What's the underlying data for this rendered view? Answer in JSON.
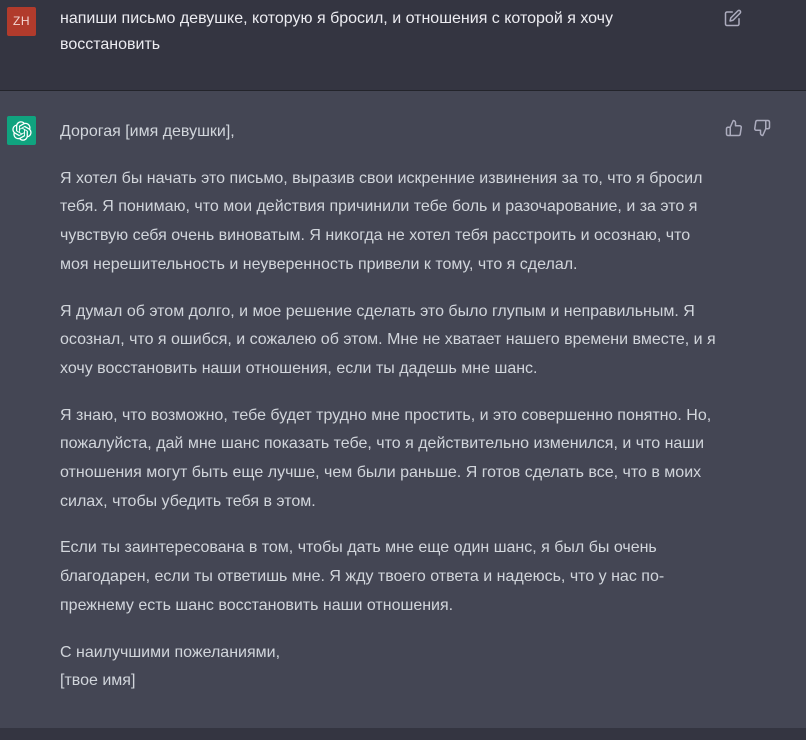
{
  "user_message": {
    "avatar_initials": "ZH",
    "text": "напиши письмо девушке, которую я бросил, и отношения с которой я хочу восстановить",
    "edit_icon": "edit-icon"
  },
  "assistant_message": {
    "avatar_icon": "openai-logo-icon",
    "greeting": "Дорогая [имя девушки],",
    "paragraphs": [
      "Я хотел бы начать это письмо, выразив свои искренние извинения за то, что я бросил тебя. Я понимаю, что мои действия причинили тебе боль и разочарование, и за это я чувствую себя очень виноватым. Я никогда не хотел тебя расстроить и осознаю, что моя нерешительность и неуверенность привели к тому, что я сделал.",
      "Я думал об этом долго, и мое решение сделать это было глупым и неправильным. Я осознал, что я ошибся, и сожалею об этом. Мне не хватает нашего времени вместе, и я хочу восстановить наши отношения, если ты дадешь мне шанс.",
      "Я знаю, что возможно, тебе будет трудно мне простить, и это совершенно понятно. Но, пожалуйста, дай мне шанс показать тебе, что я действительно изменился, и что наши отношения могут быть еще лучше, чем были раньше. Я готов сделать все, что в моих силах, чтобы убедить тебя в этом.",
      "Если ты заинтересована в том, чтобы дать мне еще один шанс, я был бы очень благодарен, если ты ответишь мне. Я жду твоего ответа и надеюсь, что у нас по-прежнему есть шанс восстановить наши отношения."
    ],
    "closing": "С наилучшими пожеланиями,",
    "signature": "[твое имя]",
    "feedback_icons": [
      "thumbs-up-icon",
      "thumbs-down-icon"
    ]
  },
  "colors": {
    "background": "#343541",
    "assistant_background": "#444654",
    "user_avatar": "#b13b2c",
    "assistant_avatar": "#10a37f",
    "text": "#d1d5db"
  }
}
